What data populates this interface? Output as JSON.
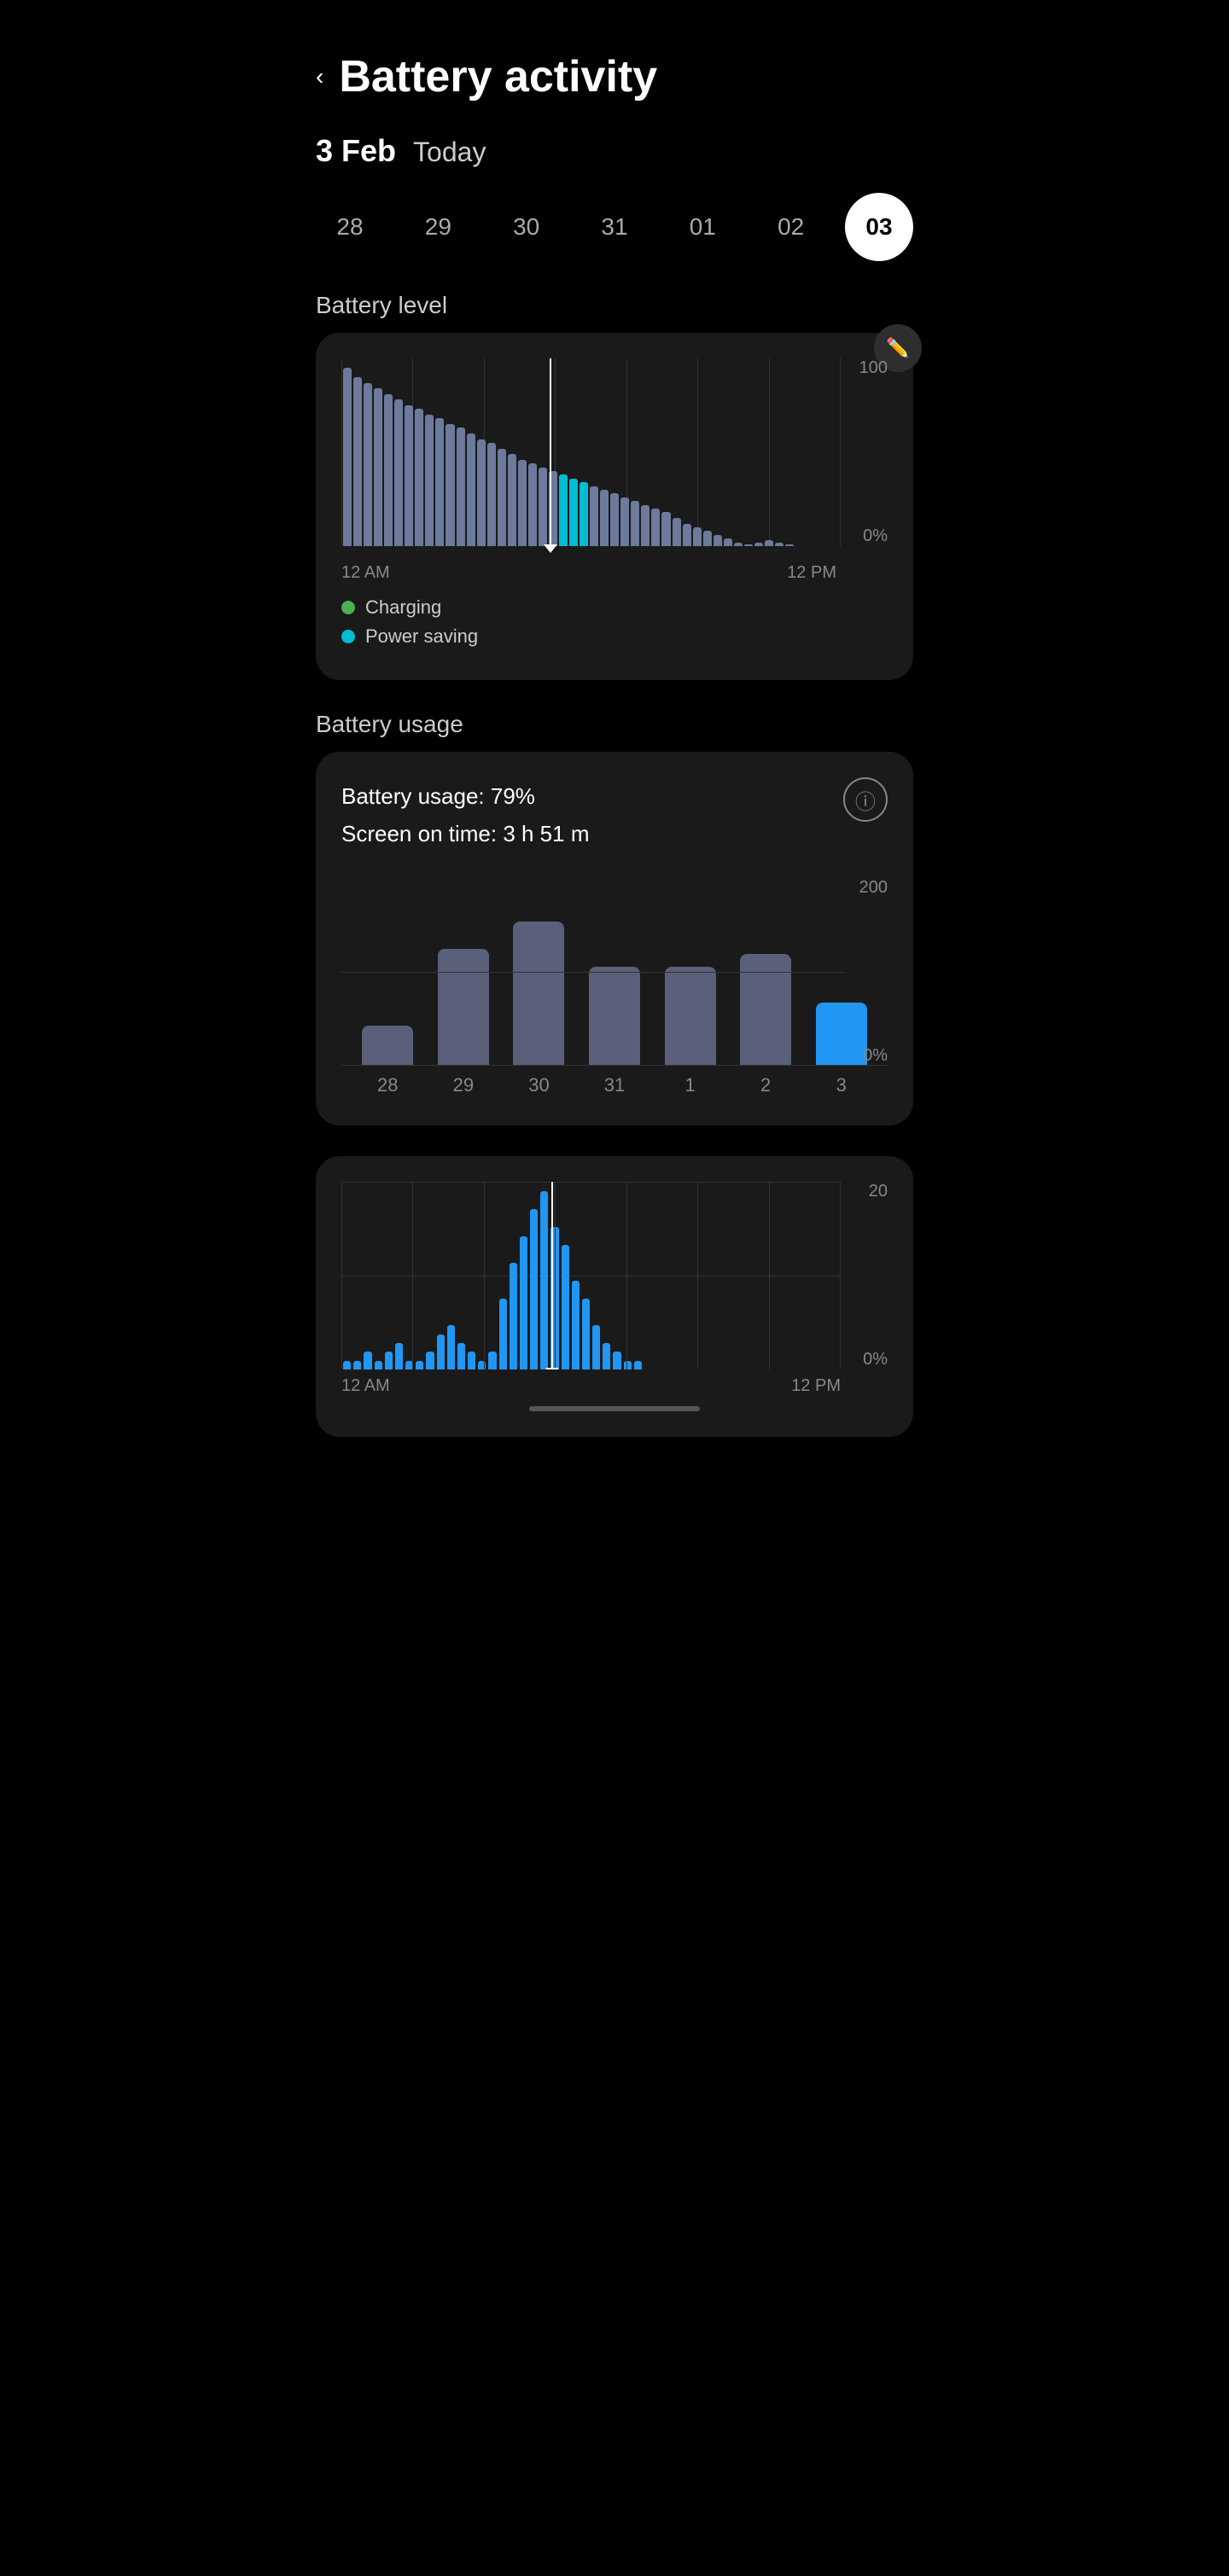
{
  "header": {
    "back_label": "‹",
    "title": "Battery activity"
  },
  "date": {
    "day_month": "3 Feb",
    "today_label": "Today"
  },
  "day_selector": {
    "days": [
      "28",
      "29",
      "30",
      "31",
      "01",
      "02",
      "03"
    ],
    "active_index": 6
  },
  "battery_level": {
    "section_label": "Battery level",
    "y_labels": [
      "100",
      "0%"
    ],
    "x_labels": [
      "12 AM",
      "12 PM"
    ],
    "legend": [
      {
        "color": "#4caf50",
        "label": "Charging"
      },
      {
        "color": "#00bcd4",
        "label": "Power saving"
      }
    ],
    "bars": [
      95,
      90,
      87,
      84,
      81,
      78,
      75,
      73,
      70,
      68,
      65,
      63,
      60,
      57,
      55,
      52,
      49,
      46,
      44,
      42,
      40,
      38,
      36,
      34,
      32,
      30,
      28,
      26,
      24,
      22,
      20,
      18,
      15,
      12,
      10,
      8,
      6,
      4,
      2,
      1,
      2,
      3,
      2,
      1,
      0,
      0,
      0,
      0
    ],
    "highlight_indices": [
      21,
      22,
      23
    ],
    "cursor_position_pct": 42
  },
  "battery_usage": {
    "section_label": "Battery usage",
    "usage_pct": "79%",
    "screen_on_time": "3 h 51 m",
    "info_icon": "ⓘ",
    "weekly_y_labels": [
      "200",
      "",
      "0%"
    ],
    "weekly_bars": [
      {
        "label": "28",
        "height_pct": 22,
        "highlight": false
      },
      {
        "label": "29",
        "height_pct": 65,
        "highlight": false
      },
      {
        "label": "30",
        "height_pct": 80,
        "highlight": false
      },
      {
        "label": "31",
        "height_pct": 55,
        "highlight": false
      },
      {
        "label": "1",
        "height_pct": 55,
        "highlight": false
      },
      {
        "label": "2",
        "height_pct": 62,
        "highlight": false
      },
      {
        "label": "3",
        "height_pct": 35,
        "highlight": true
      }
    ]
  },
  "hourly_chart": {
    "y_labels": [
      "20",
      "",
      "0%"
    ],
    "x_labels": [
      "12 AM",
      "12 PM"
    ],
    "cursor_position_pct": 42,
    "bars": [
      1,
      1,
      2,
      1,
      2,
      3,
      1,
      1,
      2,
      4,
      5,
      3,
      2,
      1,
      2,
      8,
      12,
      15,
      18,
      20,
      16,
      14,
      10,
      8,
      5,
      3,
      2,
      1,
      1,
      0,
      0,
      0,
      0,
      0,
      0,
      0,
      0,
      0,
      0,
      0,
      0,
      0,
      0,
      0,
      0,
      0,
      0,
      0
    ]
  }
}
